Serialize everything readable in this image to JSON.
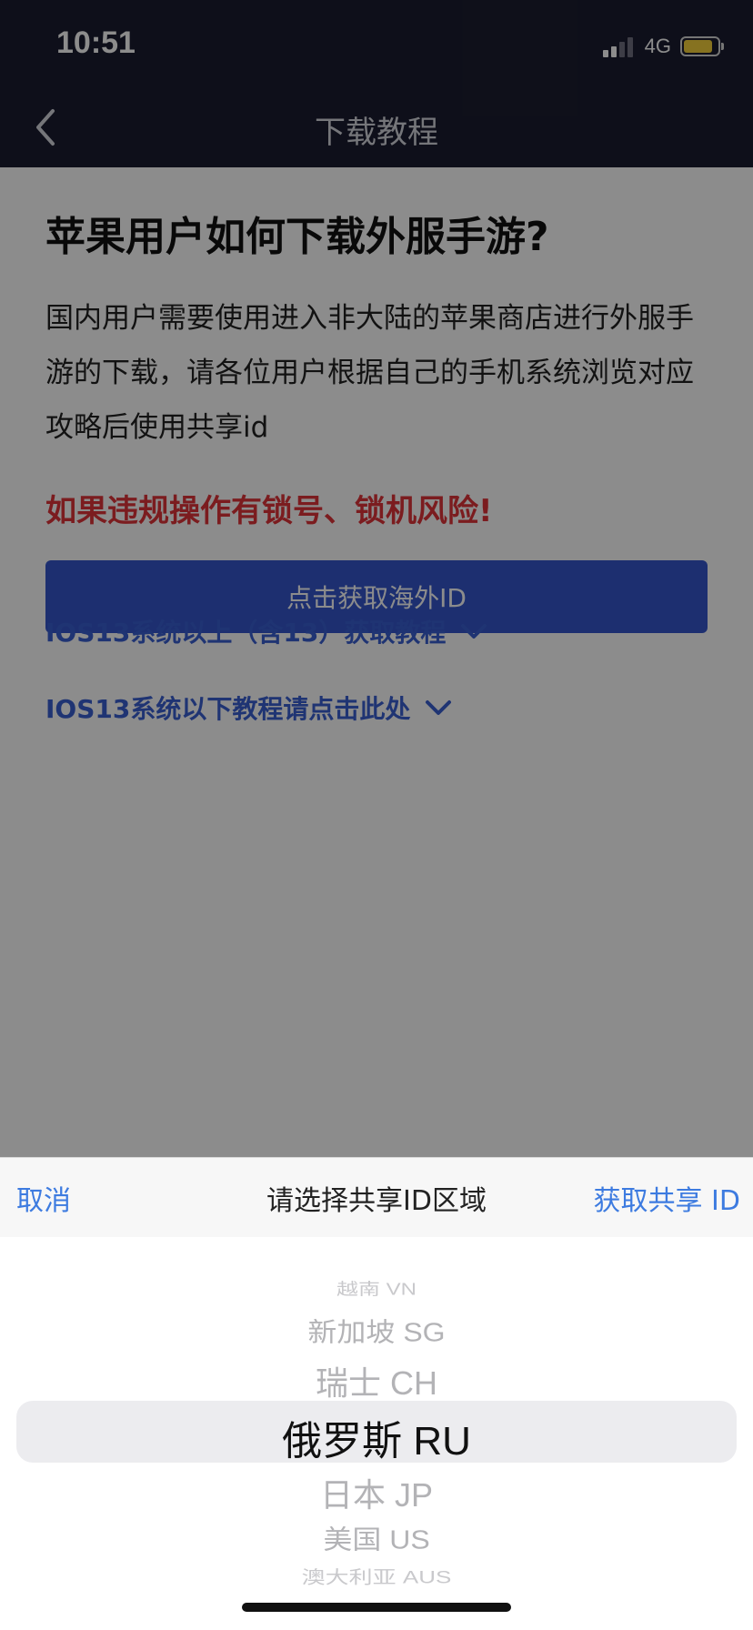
{
  "status": {
    "time": "10:51",
    "network": "4G",
    "signal_level": 2,
    "battery_level": 0.85
  },
  "nav": {
    "back_icon": "chevron-left-icon",
    "title": "下载教程"
  },
  "content": {
    "headline": "苹果用户如何下载外服手游?",
    "body": "国内用户需要使用进入非大陆的苹果商店进行外服手游的下载，请各位用户根据自己的手机系统浏览对应攻略后使用共享id",
    "warning": "如果违规操作有锁号、锁机风险!",
    "cta_label": "点击获取海外ID",
    "guides": [
      {
        "label": "IOS13系统以上（含13）获取教程",
        "icon": "chevron-down-icon"
      },
      {
        "label": "IOS13系统以下教程请点击此处",
        "icon": "chevron-down-icon"
      }
    ]
  },
  "picker": {
    "cancel_label": "取消",
    "title": "请选择共享ID区域",
    "confirm_label": "获取共享 ID",
    "items": [
      "越南 VN",
      "新加坡 SG",
      "瑞士 CH",
      "俄罗斯 RU",
      "日本 JP",
      "美国 US",
      "澳大利亚 AUS"
    ],
    "selected": "俄罗斯 RU"
  },
  "colors": {
    "header_bg": "#1b1d30",
    "accent_blue": "#3557cc",
    "link_blue": "#3a5fd1",
    "warning_red": "#e0343a",
    "toolbar_blue": "#3d7be0"
  }
}
